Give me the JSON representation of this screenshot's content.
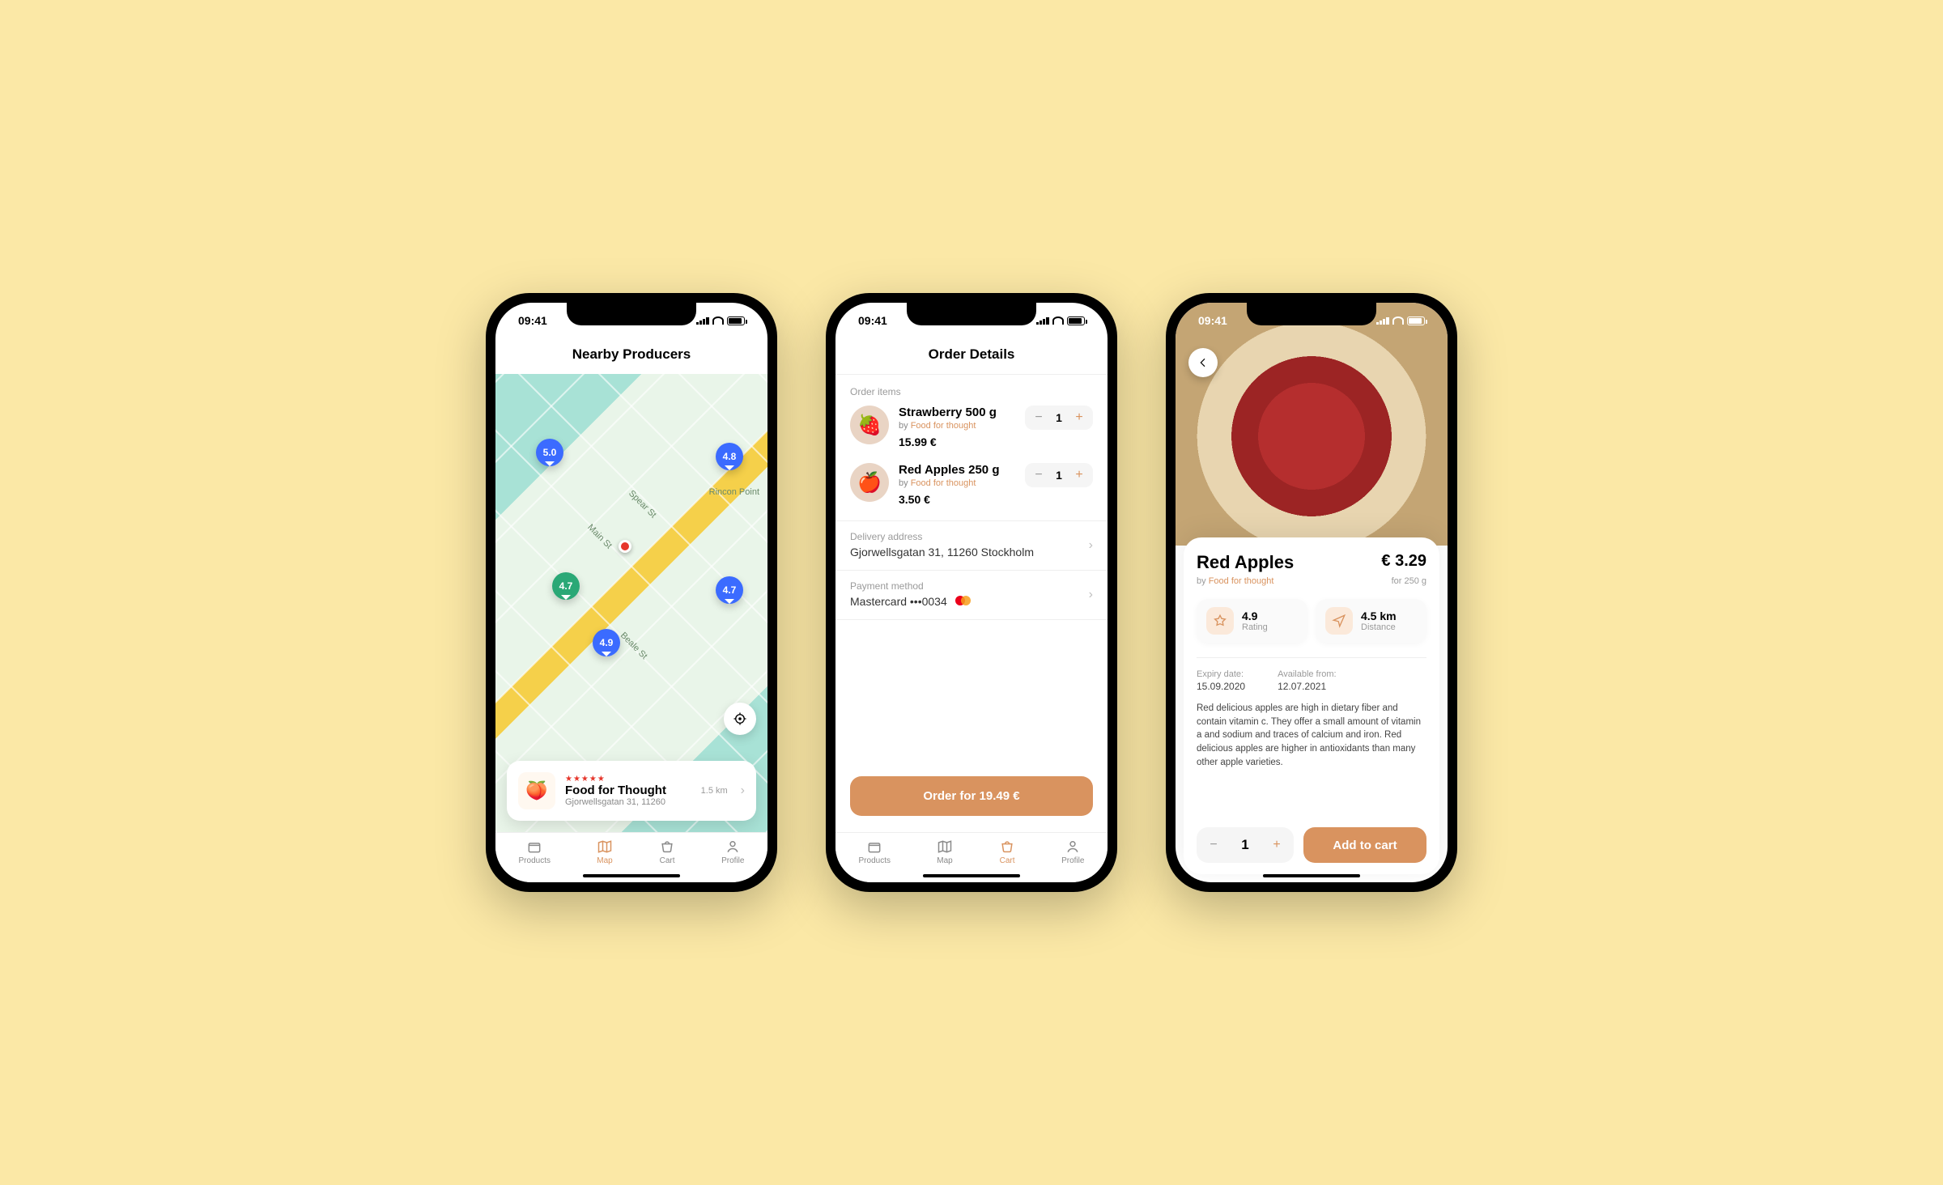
{
  "status": {
    "time": "09:41"
  },
  "tabs": {
    "products": "Products",
    "map": "Map",
    "cart": "Cart",
    "profile": "Profile"
  },
  "screen1": {
    "title": "Nearby Producers",
    "markers": [
      {
        "rating": "5.0"
      },
      {
        "rating": "4.8"
      },
      {
        "rating": "4.7"
      },
      {
        "rating": "4.7"
      },
      {
        "rating": "4.9"
      }
    ],
    "map_label": "Rincon Point",
    "streets": {
      "spear": "Spear St",
      "main": "Main St",
      "beale": "Beale St"
    },
    "card": {
      "name": "Food for Thought",
      "address": "Gjorwellsgatan 31, 11260",
      "distance": "1.5 km"
    }
  },
  "screen2": {
    "title": "Order Details",
    "order_items_label": "Order items",
    "items": [
      {
        "title": "Strawberry 500 g",
        "by_prefix": "by ",
        "producer": "Food for thought",
        "price": "15.99 €",
        "qty": "1"
      },
      {
        "title": "Red Apples 250 g",
        "by_prefix": "by ",
        "producer": "Food for thought",
        "price": "3.50 €",
        "qty": "1"
      }
    ],
    "delivery": {
      "label": "Delivery address",
      "value": "Gjorwellsgatan 31, 11260 Stockholm"
    },
    "payment": {
      "label": "Payment method",
      "value": "Mastercard •••0034"
    },
    "order_button": "Order for 19.49 €"
  },
  "screen3": {
    "name": "Red Apples",
    "price": "€ 3.29",
    "by_prefix": "by ",
    "producer": "Food for thought",
    "per": "for 250 g",
    "rating": {
      "value": "4.9",
      "label": "Rating"
    },
    "distance": {
      "value": "4.5 km",
      "label": "Distance"
    },
    "expiry": {
      "label": "Expiry date:",
      "value": "15.09.2020"
    },
    "available": {
      "label": "Available from:",
      "value": "12.07.2021"
    },
    "description": "Red delicious apples are high in dietary fiber and contain vitamin c. They offer a small amount of vitamin a and sodium and traces of calcium and iron. Red delicious apples are higher in antioxidants than many other apple varieties.",
    "qty": "1",
    "add_button": "Add to cart"
  }
}
